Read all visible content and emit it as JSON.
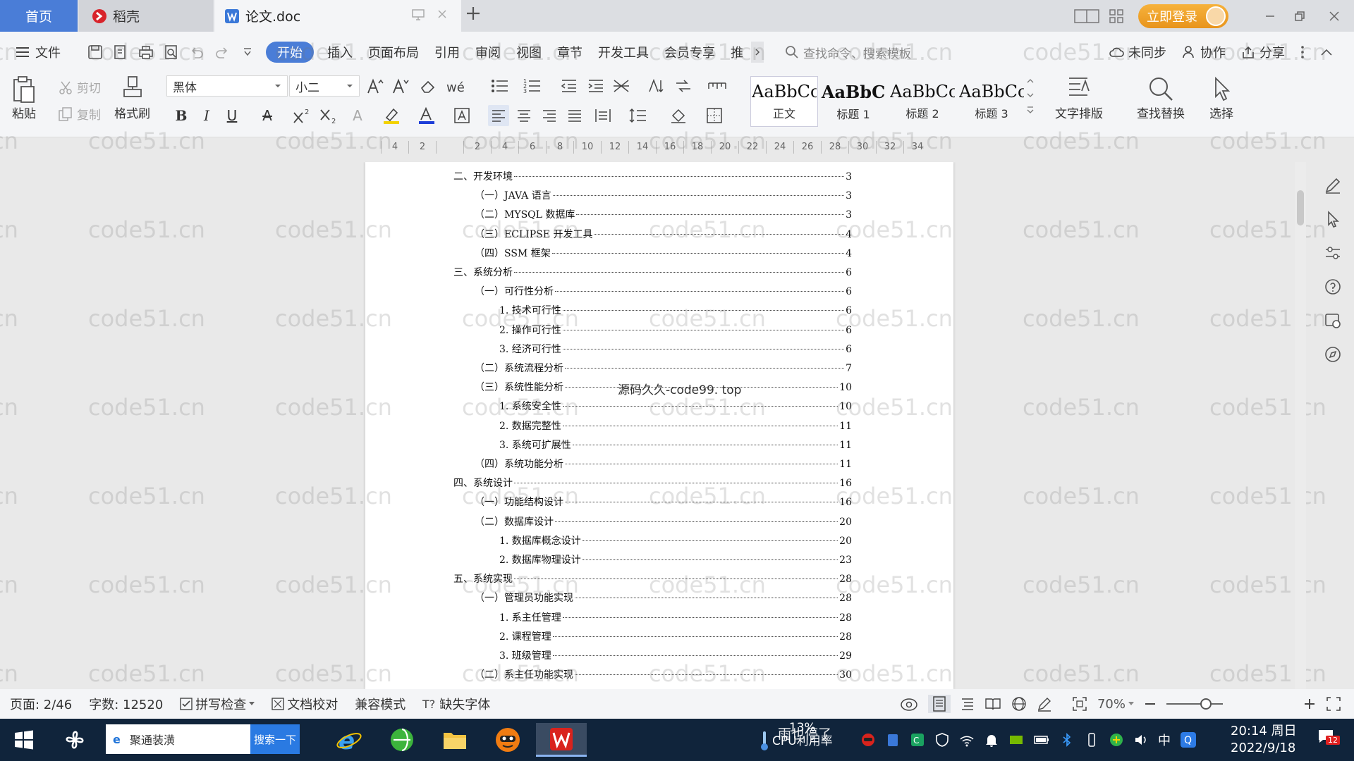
{
  "tabs": {
    "home": "首页",
    "daoke": "稻壳",
    "doc": "论文.doc"
  },
  "titlebar": {
    "login": "立即登录"
  },
  "menu": {
    "file": "文件",
    "items": [
      "开始",
      "插入",
      "页面布局",
      "引用",
      "审阅",
      "视图",
      "章节",
      "开发工具",
      "会员专享",
      "推"
    ],
    "search_cmd": "查找命令、搜索模板",
    "unsynced": "未同步",
    "collab": "协作",
    "share": "分享"
  },
  "ribbon": {
    "paste": "粘贴",
    "cut": "剪切",
    "copy": "复制",
    "format_painter": "格式刷",
    "font_name": "黑体",
    "font_size": "小二",
    "styles": [
      {
        "preview": "AaBbCcDd",
        "name": "正文"
      },
      {
        "preview": "AaBbC",
        "name": "标题 1"
      },
      {
        "preview": "AaBbCcDd",
        "name": "标题 2"
      },
      {
        "preview": "AaBbCcDd",
        "name": "标题 3"
      }
    ],
    "text_layout": "文字排版",
    "find_replace": "查找替换",
    "select": "选择"
  },
  "ruler": [
    "4",
    "2",
    "",
    "2",
    "4",
    "6",
    "8",
    "10",
    "12",
    "14",
    "16",
    "18",
    "20",
    "22",
    "24",
    "26",
    "28",
    "30",
    "32",
    "34"
  ],
  "toc": [
    {
      "level": 1,
      "text": "二、开发环境",
      "page": "3"
    },
    {
      "level": 2,
      "text": "（一）JAVA 语言",
      "page": "3"
    },
    {
      "level": 2,
      "text": "（二）MYSQL 数据库",
      "page": "3"
    },
    {
      "level": 2,
      "text": "（三）ECLIPSE 开发工具",
      "page": "4"
    },
    {
      "level": 2,
      "text": "（四）SSM 框架",
      "page": "4"
    },
    {
      "level": 1,
      "text": "三、系统分析",
      "page": "6"
    },
    {
      "level": 2,
      "text": "（一）可行性分析",
      "page": "6"
    },
    {
      "level": 3,
      "text": "1. 技术可行性",
      "page": "6"
    },
    {
      "level": 3,
      "text": "2. 操作可行性",
      "page": "6"
    },
    {
      "level": 3,
      "text": "3. 经济可行性",
      "page": "6"
    },
    {
      "level": 2,
      "text": "（二）系统流程分析",
      "page": "7"
    },
    {
      "level": 2,
      "text": "（三）系统性能分析",
      "page": "10"
    },
    {
      "level": 3,
      "text": "1. 系统安全性",
      "page": "10"
    },
    {
      "level": 3,
      "text": "2. 数据完整性",
      "page": "11"
    },
    {
      "level": 3,
      "text": "3. 系统可扩展性",
      "page": "11"
    },
    {
      "level": 2,
      "text": "（四）系统功能分析",
      "page": "11"
    },
    {
      "level": 1,
      "text": "四、系统设计",
      "page": "16"
    },
    {
      "level": 2,
      "text": "（一）功能结构设计",
      "page": "16"
    },
    {
      "level": 2,
      "text": "（二）数据库设计",
      "page": "20"
    },
    {
      "level": 3,
      "text": "1. 数据库概念设计",
      "page": "20"
    },
    {
      "level": 3,
      "text": "2. 数据库物理设计",
      "page": "23"
    },
    {
      "level": 1,
      "text": "五、系统实现",
      "page": "28"
    },
    {
      "level": 2,
      "text": "（一）管理员功能实现",
      "page": "28"
    },
    {
      "level": 3,
      "text": "1. 系主任管理",
      "page": "28"
    },
    {
      "level": 3,
      "text": "2. 课程管理",
      "page": "28"
    },
    {
      "level": 3,
      "text": "3. 班级管理",
      "page": "29"
    },
    {
      "level": 2,
      "text": "（二）系主任功能实现",
      "page": "30"
    }
  ],
  "watermark_text": "源码久久-code99. top",
  "bg_watermark": "code51.cn",
  "status": {
    "page": "页面: 2/46",
    "words": "字数: 12520",
    "spell": "拼写检查",
    "proof": "文档校对",
    "compat": "兼容模式",
    "missing_font": "缺失字体",
    "zoom": "70%",
    "zoom_fraction": 0.7
  },
  "taskbar": {
    "search_text": "聚通装潢",
    "search_btn": "搜索一下",
    "cpu_pct": "13%",
    "cpu_label": "CPU利用率",
    "cpu_overlay": "雨也停了",
    "ime": "中",
    "time": "20:14 周日",
    "date": "2022/9/18",
    "notif_count": "12"
  },
  "colors": {
    "accent": "#4a7dd7",
    "login": "#f0a22c",
    "taskbar": "#10243b"
  }
}
